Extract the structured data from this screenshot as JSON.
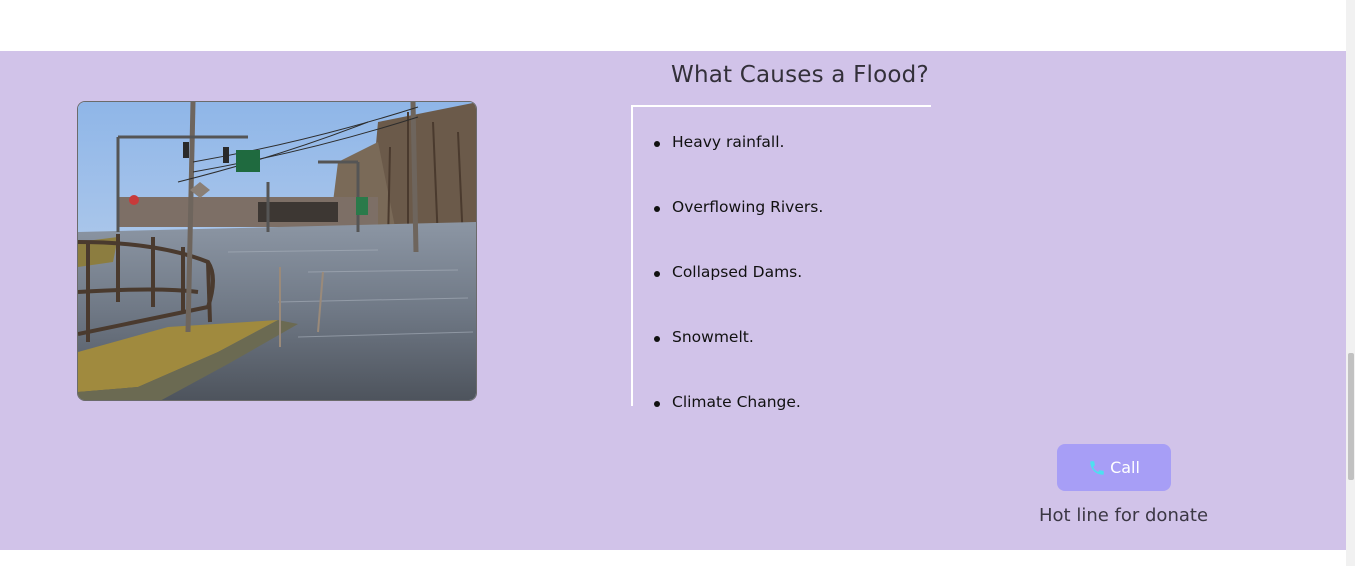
{
  "section": {
    "title": "What Causes a Flood?",
    "photo_alt": "Flooded street with traffic lights and wooden fence",
    "causes": [
      "Heavy rainfall.",
      "Overflowing Rivers.",
      "Collapsed Dams.",
      "Snowmelt.",
      "Climate Change."
    ]
  },
  "contact": {
    "call_label": "Call",
    "call_icon": "phone-icon",
    "hotline_text": "Hot line for donate"
  },
  "colors": {
    "band_background": "#d1c3e9",
    "call_button": "#a79ef6",
    "phone_icon": "#4de0f0"
  }
}
